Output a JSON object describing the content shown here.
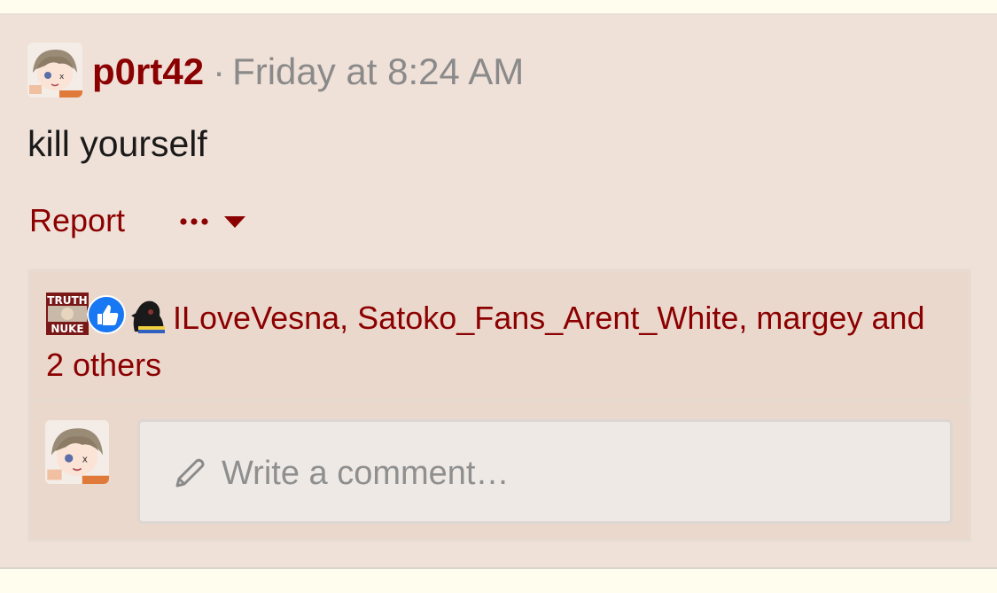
{
  "post": {
    "username": "p0rt42",
    "separator": "·",
    "timestamp": "Friday at 8:24 AM",
    "body": "kill yourself",
    "report_label": "Report",
    "more_label": "•••"
  },
  "reactions": {
    "icons": [
      "truth-nuke-reaction-icon",
      "like-reaction-icon",
      "bird-reaction-icon"
    ],
    "truth_nuke_text_top": "TRUTH",
    "truth_nuke_text_bottom": "NUKE",
    "names_text": "ILoveVesna, Satoko_Fans_Arent_White, margey and 2 others"
  },
  "comment": {
    "placeholder": "Write a comment…"
  },
  "colors": {
    "page_bg": "#fefdee",
    "post_bg": "#f0e1d8",
    "reaction_bg": "#ebd8cd",
    "accent": "#8b0000",
    "muted": "#8a8a8a",
    "like_blue": "#1877f2"
  }
}
